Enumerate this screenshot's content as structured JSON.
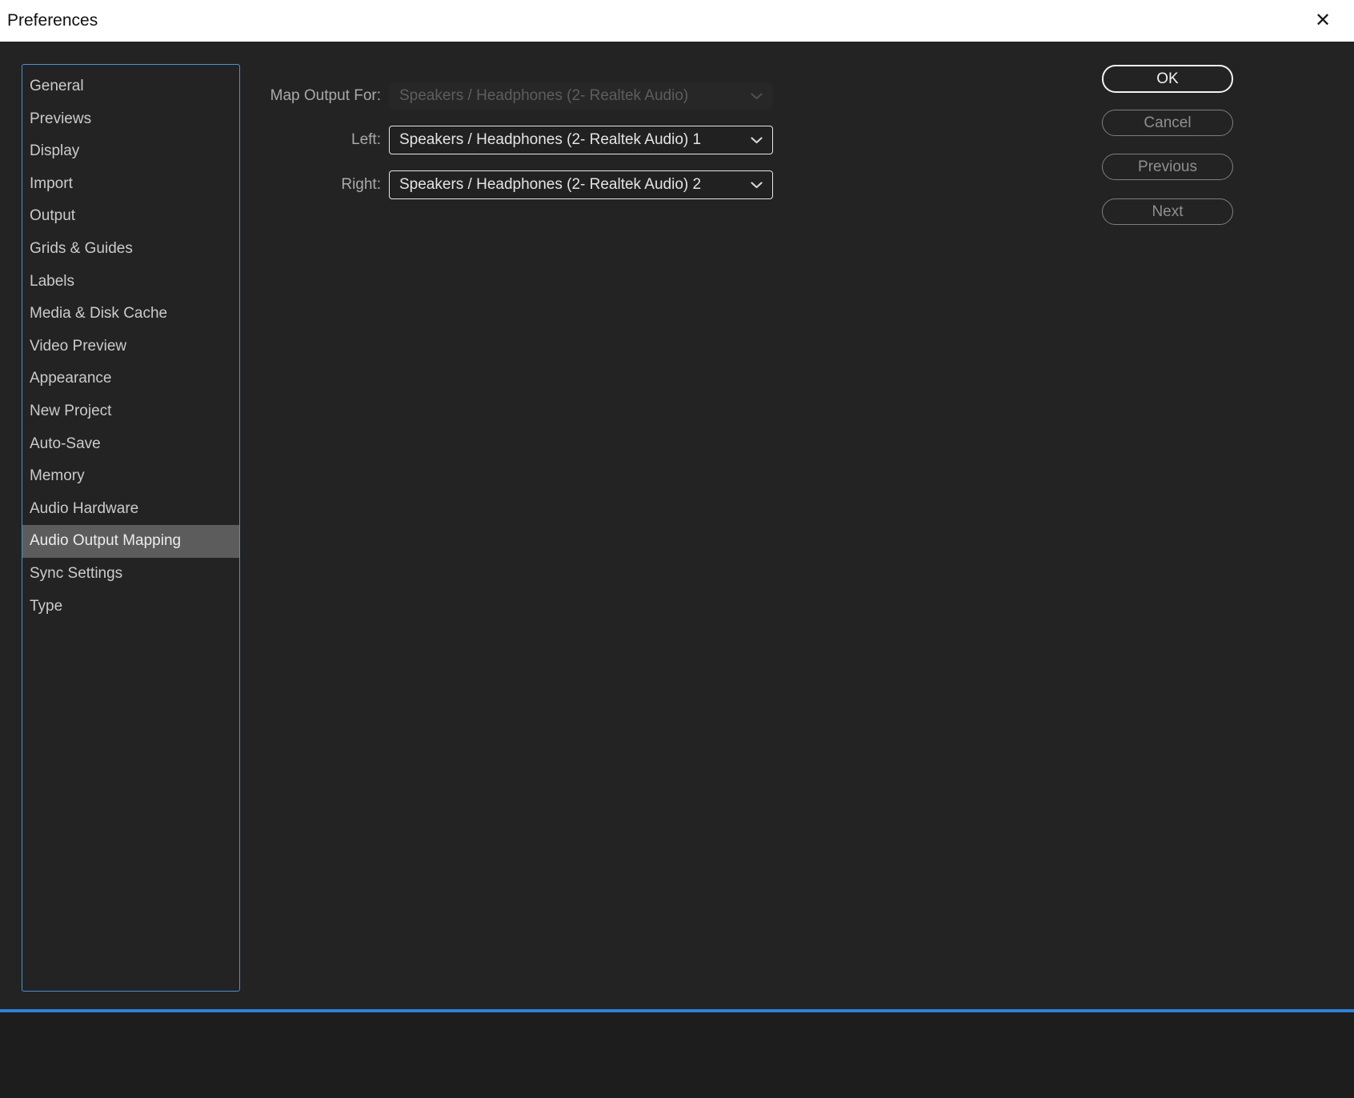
{
  "window": {
    "title": "Preferences",
    "close_glyph": "✕"
  },
  "sidebar": {
    "items": [
      {
        "label": "General",
        "selected": false
      },
      {
        "label": "Previews",
        "selected": false
      },
      {
        "label": "Display",
        "selected": false
      },
      {
        "label": "Import",
        "selected": false
      },
      {
        "label": "Output",
        "selected": false
      },
      {
        "label": "Grids & Guides",
        "selected": false
      },
      {
        "label": "Labels",
        "selected": false
      },
      {
        "label": "Media & Disk Cache",
        "selected": false
      },
      {
        "label": "Video Preview",
        "selected": false
      },
      {
        "label": "Appearance",
        "selected": false
      },
      {
        "label": "New Project",
        "selected": false
      },
      {
        "label": "Auto-Save",
        "selected": false
      },
      {
        "label": "Memory",
        "selected": false
      },
      {
        "label": "Audio Hardware",
        "selected": false
      },
      {
        "label": "Audio Output Mapping",
        "selected": true
      },
      {
        "label": "Sync Settings",
        "selected": false
      },
      {
        "label": "Type",
        "selected": false
      }
    ]
  },
  "main": {
    "fields": [
      {
        "label": "Map Output For:",
        "value": "Speakers / Headphones (2- Realtek Audio)",
        "disabled": true
      },
      {
        "label": "Left:",
        "value": "Speakers / Headphones (2- Realtek Audio) 1",
        "disabled": false
      },
      {
        "label": "Right:",
        "value": "Speakers / Headphones (2- Realtek Audio) 2",
        "disabled": false
      }
    ]
  },
  "buttons": {
    "ok": "OK",
    "cancel": "Cancel",
    "previous": "Previous",
    "next": "Next"
  },
  "colors": {
    "background": "#232323",
    "titlebar": "#ffffff",
    "sidebar_border": "#4a90d9",
    "selected_item_bg": "#5c5c5c",
    "accent_blue": "#2e82d8"
  }
}
